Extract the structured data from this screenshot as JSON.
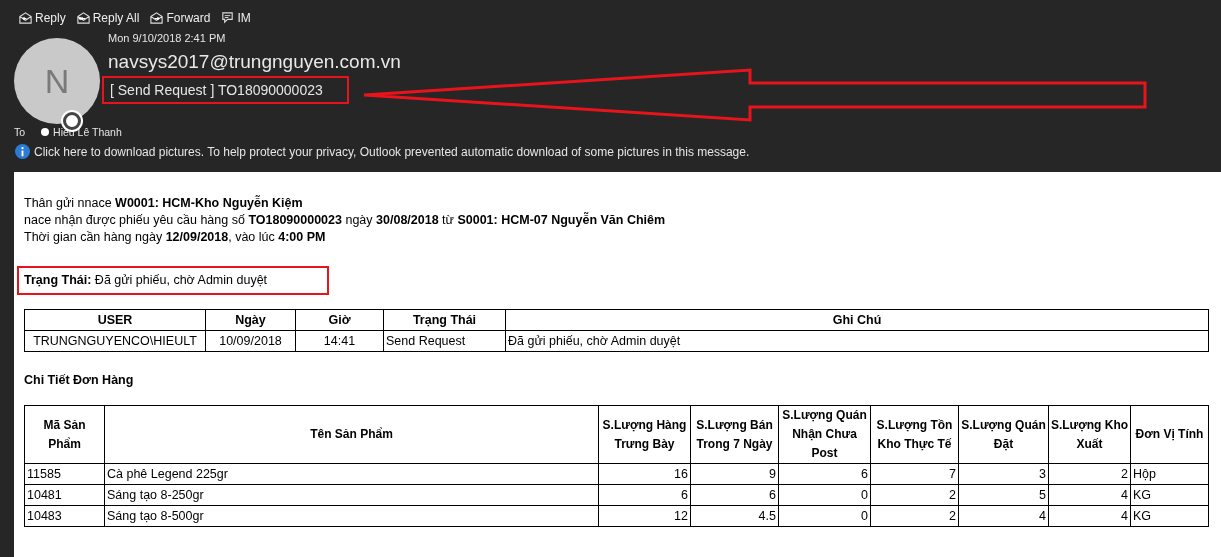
{
  "toolbar": [
    {
      "label": "Reply",
      "kind": "reply"
    },
    {
      "label": "Reply All",
      "kind": "replyall"
    },
    {
      "label": "Forward",
      "kind": "forward"
    },
    {
      "label": "IM",
      "kind": "im"
    }
  ],
  "message": {
    "date": "Mon 9/10/2018 2:41 PM",
    "avatar_letter": "N",
    "sender": "navsys2017@trungnguyen.com.vn",
    "subject": "[ Send Request ] TO18090000023",
    "to_label": "To",
    "recipient": "Hiếu Lê Thanh",
    "info": "Click here to download pictures. To help protect your privacy, Outlook prevented automatic download of some pictures in this message."
  },
  "body": {
    "lines": [
      "Thân gửi nnace **W0001: HCM-Kho Nguyễn Kiệm**",
      "nace nhận được phiếu yêu cầu hàng số **TO18090000023** ngày **30/08/2018** từ **S0001: HCM-07 Nguyễn Văn Chiêm**",
      "Thời gian cần hàng ngày **12/09/2018**, vào lúc **4:00 PM**"
    ],
    "status_line": "**Trạng Thái:** Đã gửi phiếu, chờ Admin duyệt",
    "history": {
      "columns": [
        "USER",
        "Ngày",
        "Giờ",
        "Trạng Thái",
        "Ghi Chú"
      ],
      "rows": [
        [
          "TRUNGNGUYENCO\\HIEULT",
          "10/09/2018",
          "14:41",
          "Send Request",
          "Đã gửi phiếu, chờ Admin duyệt"
        ]
      ]
    },
    "section_title": "Chi Tiết Đơn Hàng",
    "products": {
      "columns": [
        "Mã Sản Phẩm",
        "Tên Sản Phẩm",
        "S.Lượng Hàng Trưng Bày",
        "S.Lượng Bán Trong 7 Ngày",
        "S.Lượng Quán Nhận Chưa Post",
        "S.Lượng Tồn Kho Thực Tế",
        "S.Lượng Quán Đặt",
        "S.Lượng Kho Xuất",
        "Đơn Vị Tính"
      ],
      "rows": [
        [
          "11585",
          "Cà phê Legend 225gr",
          "16",
          "9",
          "6",
          "7",
          "3",
          "2",
          "Hộp"
        ],
        [
          "10481",
          "Sáng tạo 8-250gr",
          "6",
          "6",
          "0",
          "2",
          "5",
          "4",
          "KG"
        ],
        [
          "10483",
          "Sáng tạo 8-500gr",
          "12",
          "4.5",
          "0",
          "2",
          "4",
          "4",
          "KG"
        ]
      ]
    }
  }
}
